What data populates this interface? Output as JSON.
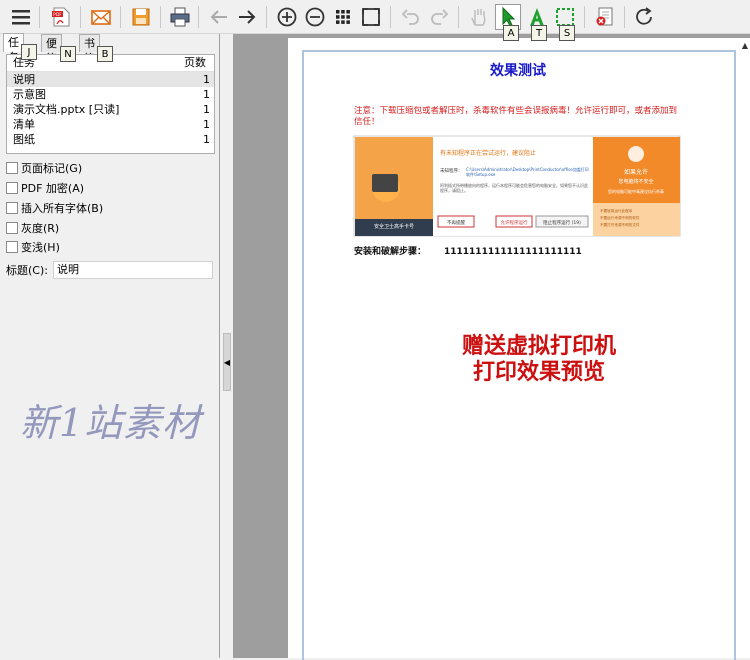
{
  "toolbar": {
    "badges": {
      "j": "J",
      "n": "N",
      "b": "B",
      "a1": "A",
      "t": "T",
      "s": "S"
    },
    "pdf_icon_label": "PDF"
  },
  "tabs": {
    "task": "任务",
    "note": "便笺",
    "bookmark": "书签"
  },
  "task_list": {
    "header": {
      "name": "任务",
      "pages": "页数"
    },
    "rows": [
      {
        "name": "说明",
        "pages": "1"
      },
      {
        "name": "示意图",
        "pages": "1"
      },
      {
        "name": "演示文档.pptx [只读]",
        "pages": "1"
      },
      {
        "name": "清单",
        "pages": "1"
      },
      {
        "name": "图纸",
        "pages": "1"
      }
    ]
  },
  "options": {
    "page_mark": "页面标记(G)",
    "pdf_encrypt": "PDF 加密(A)",
    "embed_fonts": "插入所有字体(B)",
    "grayscale": "灰度(R)",
    "lighten": "变浅(H)"
  },
  "title_field": {
    "label": "标题(C):",
    "value": "说明"
  },
  "watermark": "新1站素材",
  "document": {
    "heading": "效果测试",
    "notice": "注意：下载压缩包或者解压时，杀毒软件有些会误报病毒！允许运行即可，或者添加到信任！",
    "steps_label": "安装和破解步骤：",
    "steps_value": "1111111111111111111111",
    "promo_line1": "赠送虚拟打印机",
    "promo_line2": "打印效果预览",
    "screenshot": {
      "dialog_title": "有未知程序正在尝试运行，建议阻止",
      "dialog_path_label": "未知程序：",
      "dialog_path": "C:\\Users\\Administrator\\Desktop\\PrintConductor\\office加盖打印软件\\Setup.exe",
      "dialog_body": "阿利插式所带播放向的程序，运行本程序可能会危害您的电脑安全。如果您不认识此程序，请阻止。",
      "btn_block": "不再提醒",
      "btn_allow": "允许程序运行",
      "btn_stop": "阻止程序运行 (19)",
      "banner_text": "安全卫士高手卡号",
      "side_title": "如果允许",
      "side_sub": "您电脑将不安全",
      "side_body": "您的电脑可能中毒建议执行杀毒",
      "side_items": [
        "不要轻易运行此程序",
        "不要运行来源不明的软件",
        "不要打开来源不明的文件"
      ]
    }
  },
  "colors": {
    "heading": "#1a1ac8",
    "notice": "#d42020",
    "promo": "#cc1010",
    "accent_orange": "#f28a2a"
  }
}
